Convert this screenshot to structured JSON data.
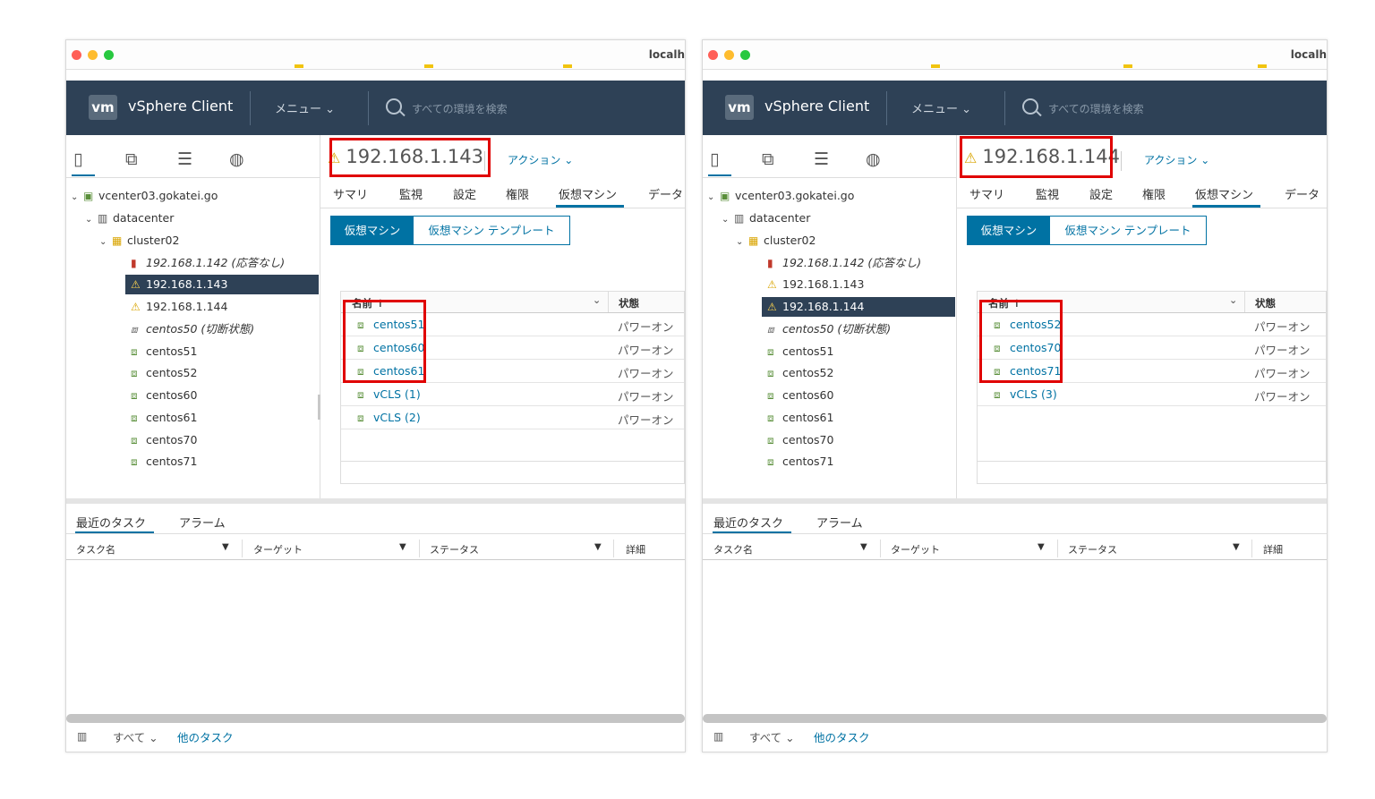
{
  "windows": [
    {
      "url": "localh",
      "app_title": "vSphere Client",
      "menu_label": "メニュー ⌄",
      "search_placeholder": "すべての環境を検索",
      "host_title": "192.168.1.143",
      "actions_label": "アクション ⌄",
      "tabs": [
        "サマリ",
        "監視",
        "設定",
        "権限",
        "仮想マシン",
        "データ"
      ],
      "active_tab": "仮想マシン",
      "vm_buttons": [
        "仮想マシン",
        "仮想マシン テンプレート"
      ],
      "tree": [
        {
          "label": "vcenter03.gokatei.go",
          "icon": "vcenter-icon"
        },
        {
          "label": "datacenter",
          "icon": "datacenter-icon"
        },
        {
          "label": "cluster02",
          "icon": "cluster-icon"
        },
        {
          "label": "192.168.1.142 (応答なし)",
          "icon": "host-error-icon"
        },
        {
          "label": "192.168.1.143",
          "icon": "host-warning-icon",
          "selected": true
        },
        {
          "label": "192.168.1.144",
          "icon": "host-warning-icon"
        },
        {
          "label": "centos50 (切断状態)",
          "icon": "vm-icon"
        },
        {
          "label": "centos51",
          "icon": "vm-icon"
        },
        {
          "label": "centos52",
          "icon": "vm-icon"
        },
        {
          "label": "centos60",
          "icon": "vm-icon"
        },
        {
          "label": "centos61",
          "icon": "vm-icon"
        },
        {
          "label": "centos70",
          "icon": "vm-icon"
        },
        {
          "label": "centos71",
          "icon": "vm-icon"
        }
      ],
      "grid_headers": {
        "name": "名前 ↑",
        "state": "状態"
      },
      "grid_rows": [
        {
          "name": "centos51",
          "state": "パワーオン"
        },
        {
          "name": "centos60",
          "state": "パワーオン"
        },
        {
          "name": "centos61",
          "state": "パワーオン"
        },
        {
          "name": "vCLS (1)",
          "state": "パワーオン"
        },
        {
          "name": "vCLS (2)",
          "state": "パワーオン"
        }
      ],
      "bottom_tabs": [
        "最近のタスク",
        "アラーム"
      ],
      "task_columns": [
        "タスク名",
        "ターゲット",
        "ステータス",
        "詳細"
      ],
      "footer": {
        "all": "すべて ⌄",
        "more": "他のタスク"
      }
    },
    {
      "url": "localh",
      "app_title": "vSphere Client",
      "menu_label": "メニュー ⌄",
      "search_placeholder": "すべての環境を検索",
      "host_title": "192.168.1.144",
      "actions_label": "アクション ⌄",
      "tabs": [
        "サマリ",
        "監視",
        "設定",
        "権限",
        "仮想マシン",
        "データ"
      ],
      "active_tab": "仮想マシン",
      "vm_buttons": [
        "仮想マシン",
        "仮想マシン テンプレート"
      ],
      "tree": [
        {
          "label": "vcenter03.gokatei.go",
          "icon": "vcenter-icon"
        },
        {
          "label": "datacenter",
          "icon": "datacenter-icon"
        },
        {
          "label": "cluster02",
          "icon": "cluster-icon"
        },
        {
          "label": "192.168.1.142 (応答なし)",
          "icon": "host-error-icon"
        },
        {
          "label": "192.168.1.143",
          "icon": "host-warning-icon"
        },
        {
          "label": "192.168.1.144",
          "icon": "host-warning-icon",
          "selected": true
        },
        {
          "label": "centos50 (切断状態)",
          "icon": "vm-icon"
        },
        {
          "label": "centos51",
          "icon": "vm-icon"
        },
        {
          "label": "centos52",
          "icon": "vm-icon"
        },
        {
          "label": "centos60",
          "icon": "vm-icon"
        },
        {
          "label": "centos61",
          "icon": "vm-icon"
        },
        {
          "label": "centos70",
          "icon": "vm-icon"
        },
        {
          "label": "centos71",
          "icon": "vm-icon"
        }
      ],
      "grid_headers": {
        "name": "名前 ↑",
        "state": "状態"
      },
      "grid_rows": [
        {
          "name": "centos52",
          "state": "パワーオン"
        },
        {
          "name": "centos70",
          "state": "パワーオン"
        },
        {
          "name": "centos71",
          "state": "パワーオン"
        },
        {
          "name": "vCLS (3)",
          "state": "パワーオン"
        }
      ],
      "bottom_tabs": [
        "最近のタスク",
        "アラーム"
      ],
      "task_columns": [
        "タスク名",
        "ターゲット",
        "ステータス",
        "詳細"
      ],
      "footer": {
        "all": "すべて ⌄",
        "more": "他のタスク"
      }
    }
  ],
  "colors": {
    "header_bg": "#2e4156",
    "accent": "#0072a3",
    "highlight_box": "#e00000",
    "selected_row": "#2e4156"
  }
}
